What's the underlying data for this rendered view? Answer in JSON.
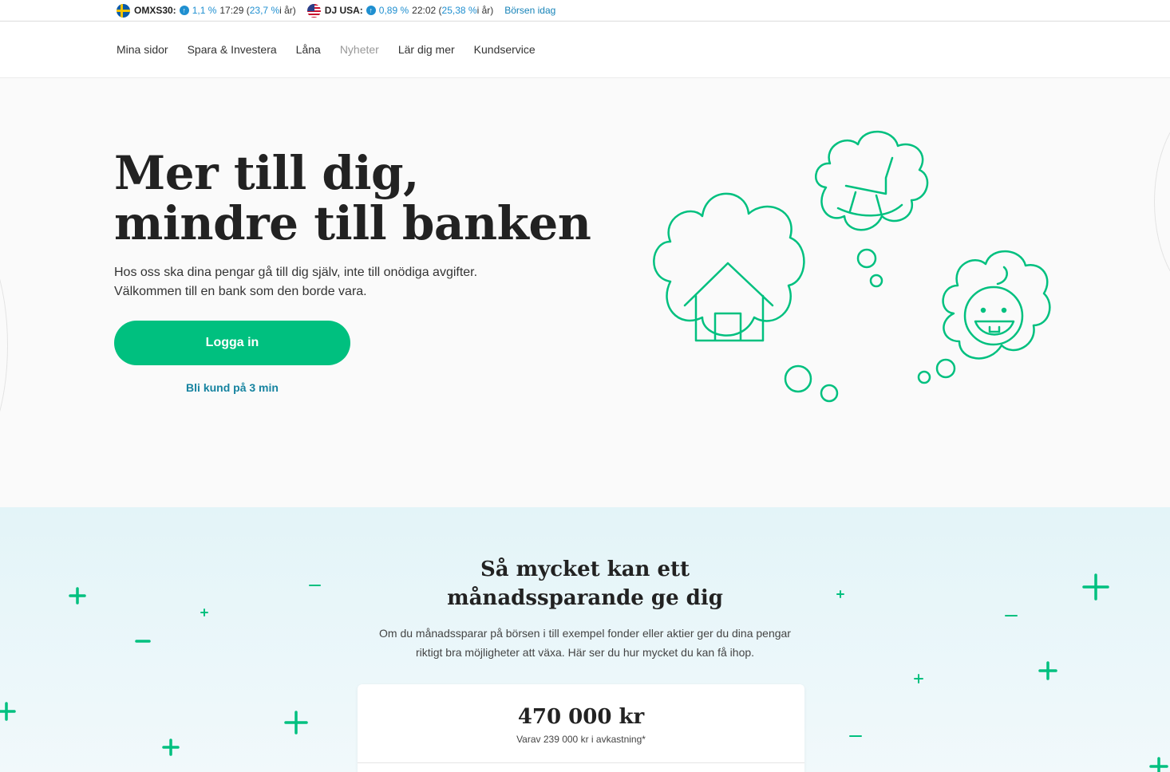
{
  "ticker": {
    "items": [
      {
        "flag": "sweden-flag-icon",
        "name": "OMXS30:",
        "change": "1,1 %",
        "time": "17:29",
        "year_open": "(",
        "year_value": "23,7 %",
        "year_suffix": " i år)"
      },
      {
        "flag": "usa-flag-icon",
        "name": "DJ USA:",
        "change": "0,89 %",
        "time": "22:02",
        "year_open": "(",
        "year_value": "25,38 %",
        "year_suffix": " i år)"
      }
    ],
    "link": "Börsen idag",
    "up_icon": "arrow-up-icon"
  },
  "nav": {
    "items": [
      "Mina sidor",
      "Spara & Investera",
      "Låna",
      "Nyheter",
      "Lär dig mer",
      "Kundservice"
    ]
  },
  "hero": {
    "title_line1": "Mer till dig,",
    "title_line2": "mindre till banken",
    "sub_line1": "Hos oss ska dina pengar gå till dig själv, inte till onödiga avgifter.",
    "sub_line2": "Välkommen till en bank som den borde vara.",
    "login_button": "Logga in",
    "signup_link": "Bli kund på 3 min",
    "illustration_icons": [
      "house-icon",
      "rocking-chair-icon",
      "baby-face-icon"
    ]
  },
  "savings": {
    "title_line1": "Så mycket kan ett",
    "title_line2": "månadssparande ge dig",
    "desc_line1": "Om du månadssparar på börsen i till exempel fonder eller aktier ger du dina pengar",
    "desc_line2": "riktigt bra möjligheter att växa. Här ser du hur mycket du kan få ihop.",
    "amount": "470 000 kr",
    "note": "Varav 239 000 kr i avkastning*"
  },
  "colors": {
    "accent_green": "#00c07f",
    "link_teal": "#1683a0",
    "ticker_blue": "#1f8fd0"
  }
}
